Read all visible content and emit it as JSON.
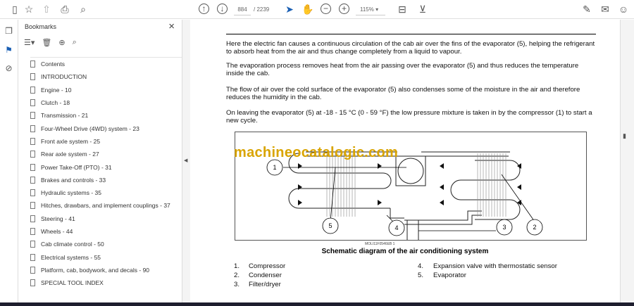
{
  "toolbar": {
    "page_current": "884",
    "page_total": "/ 2239",
    "zoom": "115%"
  },
  "bookmarks": {
    "title": "Bookmarks",
    "items": [
      "Contents",
      "INTRODUCTION",
      "Engine - 10",
      "Clutch - 18",
      "Transmission - 21",
      "Four-Wheel Drive (4WD) system - 23",
      "Front axle system - 25",
      "Rear axle system - 27",
      "Power Take-Off (PTO) - 31",
      "Brakes and controls - 33",
      "Hydraulic systems - 35",
      "Hitches, drawbars, and implement couplings - 37",
      "Steering - 41",
      "Wheels - 44",
      "Cab climate control - 50",
      "Electrical systems - 55",
      "Platform, cab, bodywork, and decals - 90",
      "SPECIAL TOOL INDEX"
    ]
  },
  "document": {
    "paragraphs": [
      "Here the electric fan causes a continuous circulation of the cab air over the fins of the evaporator (5), helping the refrigerant to absorb heat from the air and thus change completely from a liquid to vapour.",
      "The evaporation process removes heat from the air passing over the evaporator (5) and thus reduces the temperature inside the cab.",
      "The flow of air over the cold surface of the evaporator (5) also condenses some of the moisture in the air and therefore reduces the humidity in the cab.",
      "On leaving the evaporator (5) at -18 - 15 °C (0 - 59 °F) the low pressure mixture is taken in by the compressor (1) to start a new cycle."
    ],
    "watermark": "machineocatalogic.com",
    "figure_id": "MOLI11F0546EB    1",
    "caption": "Schematic diagram of the air conditioning system",
    "callouts": [
      "1",
      "2",
      "3",
      "4",
      "5"
    ],
    "legend": [
      {
        "num": "1.",
        "label": "Compressor"
      },
      {
        "num": "2.",
        "label": "Condenser"
      },
      {
        "num": "3.",
        "label": "Filter/dryer"
      },
      {
        "num": "4.",
        "label": "Expansion valve with thermostatic sensor"
      },
      {
        "num": "5.",
        "label": "Evaporator"
      }
    ]
  }
}
